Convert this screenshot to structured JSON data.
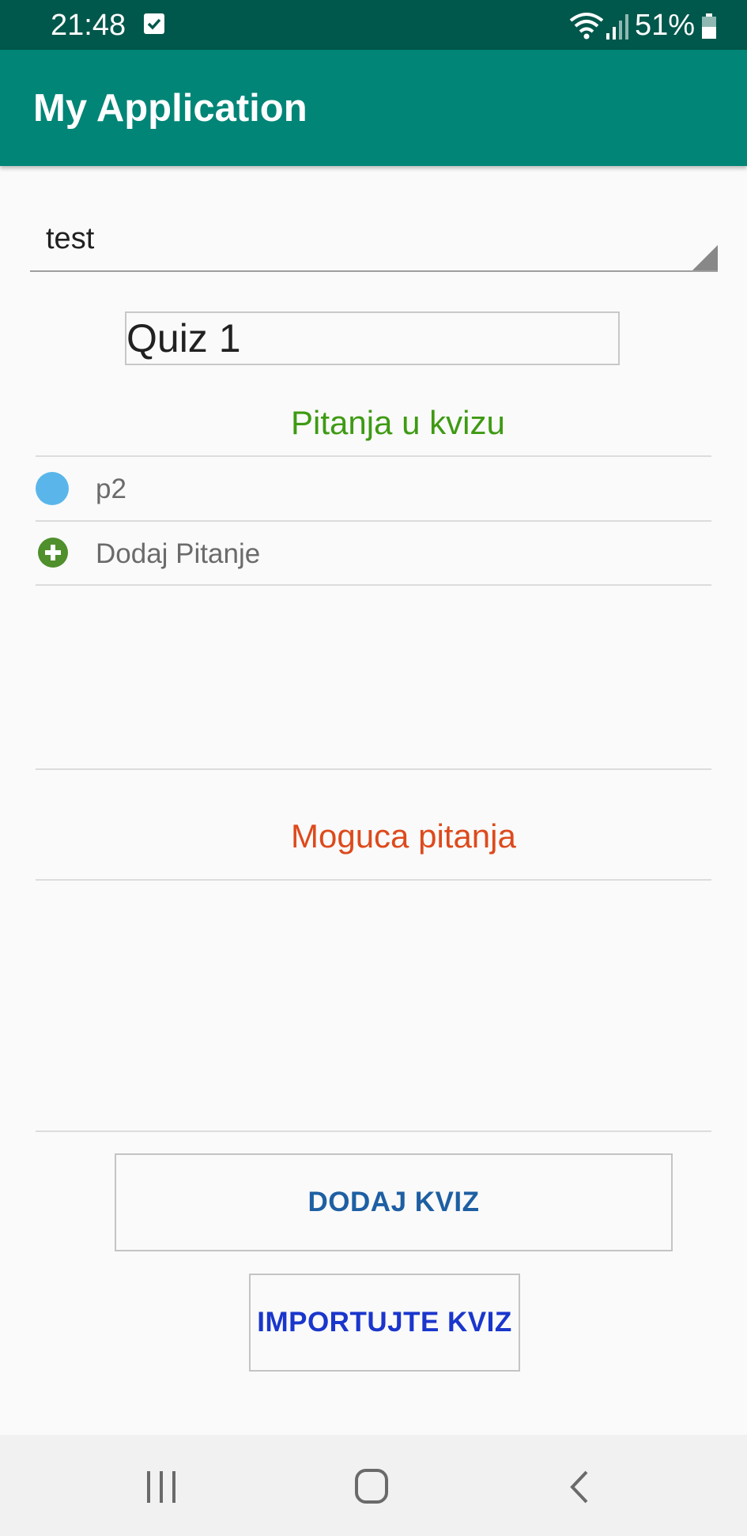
{
  "status_bar": {
    "time": "21:48",
    "battery": "51%",
    "icons": [
      "check-square-icon",
      "wifi-icon",
      "signal-icon",
      "battery-icon"
    ]
  },
  "app_bar": {
    "title": "My Application"
  },
  "spinner": {
    "selected": "test"
  },
  "quiz_name": {
    "value": "Quiz 1"
  },
  "questions_section": {
    "title": "Pitanja u kvizu",
    "items": [
      {
        "label": "p2",
        "icon": "blue-dot-icon"
      },
      {
        "label": "Dodaj Pitanje",
        "icon": "plus-circle-icon"
      }
    ]
  },
  "possible_section": {
    "title": "Moguca pitanja"
  },
  "buttons": {
    "add_quiz": "DODAJ KVIZ",
    "import_quiz": "IMPORTUJTE KVIZ"
  },
  "nav_bar": {
    "icons": [
      "recent-apps-icon",
      "home-icon",
      "back-icon"
    ]
  },
  "colors": {
    "status_bar": "#00574b",
    "app_bar": "#008577",
    "questions_title": "#3e9a13",
    "possible_title": "#dd4a1c",
    "add_button_text": "#1e5fa3",
    "import_button_text": "#1a36cc"
  }
}
